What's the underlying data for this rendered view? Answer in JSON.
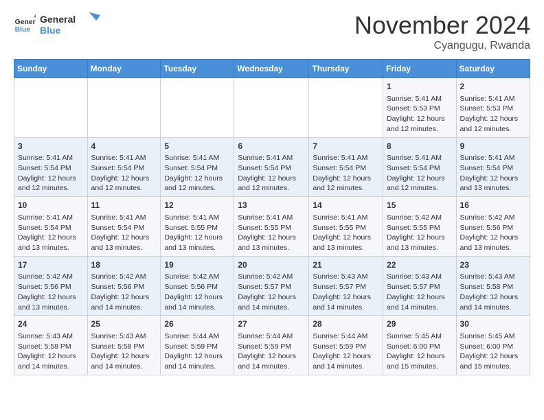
{
  "header": {
    "logo_line1": "General",
    "logo_line2": "Blue",
    "month": "November 2024",
    "location": "Cyangugu, Rwanda"
  },
  "weekdays": [
    "Sunday",
    "Monday",
    "Tuesday",
    "Wednesday",
    "Thursday",
    "Friday",
    "Saturday"
  ],
  "weeks": [
    [
      {
        "day": "",
        "info": ""
      },
      {
        "day": "",
        "info": ""
      },
      {
        "day": "",
        "info": ""
      },
      {
        "day": "",
        "info": ""
      },
      {
        "day": "",
        "info": ""
      },
      {
        "day": "1",
        "info": "Sunrise: 5:41 AM\nSunset: 5:53 PM\nDaylight: 12 hours\nand 12 minutes."
      },
      {
        "day": "2",
        "info": "Sunrise: 5:41 AM\nSunset: 5:53 PM\nDaylight: 12 hours\nand 12 minutes."
      }
    ],
    [
      {
        "day": "3",
        "info": "Sunrise: 5:41 AM\nSunset: 5:54 PM\nDaylight: 12 hours\nand 12 minutes."
      },
      {
        "day": "4",
        "info": "Sunrise: 5:41 AM\nSunset: 5:54 PM\nDaylight: 12 hours\nand 12 minutes."
      },
      {
        "day": "5",
        "info": "Sunrise: 5:41 AM\nSunset: 5:54 PM\nDaylight: 12 hours\nand 12 minutes."
      },
      {
        "day": "6",
        "info": "Sunrise: 5:41 AM\nSunset: 5:54 PM\nDaylight: 12 hours\nand 12 minutes."
      },
      {
        "day": "7",
        "info": "Sunrise: 5:41 AM\nSunset: 5:54 PM\nDaylight: 12 hours\nand 12 minutes."
      },
      {
        "day": "8",
        "info": "Sunrise: 5:41 AM\nSunset: 5:54 PM\nDaylight: 12 hours\nand 12 minutes."
      },
      {
        "day": "9",
        "info": "Sunrise: 5:41 AM\nSunset: 5:54 PM\nDaylight: 12 hours\nand 13 minutes."
      }
    ],
    [
      {
        "day": "10",
        "info": "Sunrise: 5:41 AM\nSunset: 5:54 PM\nDaylight: 12 hours\nand 13 minutes."
      },
      {
        "day": "11",
        "info": "Sunrise: 5:41 AM\nSunset: 5:54 PM\nDaylight: 12 hours\nand 13 minutes."
      },
      {
        "day": "12",
        "info": "Sunrise: 5:41 AM\nSunset: 5:55 PM\nDaylight: 12 hours\nand 13 minutes."
      },
      {
        "day": "13",
        "info": "Sunrise: 5:41 AM\nSunset: 5:55 PM\nDaylight: 12 hours\nand 13 minutes."
      },
      {
        "day": "14",
        "info": "Sunrise: 5:41 AM\nSunset: 5:55 PM\nDaylight: 12 hours\nand 13 minutes."
      },
      {
        "day": "15",
        "info": "Sunrise: 5:42 AM\nSunset: 5:55 PM\nDaylight: 12 hours\nand 13 minutes."
      },
      {
        "day": "16",
        "info": "Sunrise: 5:42 AM\nSunset: 5:56 PM\nDaylight: 12 hours\nand 13 minutes."
      }
    ],
    [
      {
        "day": "17",
        "info": "Sunrise: 5:42 AM\nSunset: 5:56 PM\nDaylight: 12 hours\nand 13 minutes."
      },
      {
        "day": "18",
        "info": "Sunrise: 5:42 AM\nSunset: 5:56 PM\nDaylight: 12 hours\nand 14 minutes."
      },
      {
        "day": "19",
        "info": "Sunrise: 5:42 AM\nSunset: 5:56 PM\nDaylight: 12 hours\nand 14 minutes."
      },
      {
        "day": "20",
        "info": "Sunrise: 5:42 AM\nSunset: 5:57 PM\nDaylight: 12 hours\nand 14 minutes."
      },
      {
        "day": "21",
        "info": "Sunrise: 5:43 AM\nSunset: 5:57 PM\nDaylight: 12 hours\nand 14 minutes."
      },
      {
        "day": "22",
        "info": "Sunrise: 5:43 AM\nSunset: 5:57 PM\nDaylight: 12 hours\nand 14 minutes."
      },
      {
        "day": "23",
        "info": "Sunrise: 5:43 AM\nSunset: 5:58 PM\nDaylight: 12 hours\nand 14 minutes."
      }
    ],
    [
      {
        "day": "24",
        "info": "Sunrise: 5:43 AM\nSunset: 5:58 PM\nDaylight: 12 hours\nand 14 minutes."
      },
      {
        "day": "25",
        "info": "Sunrise: 5:43 AM\nSunset: 5:58 PM\nDaylight: 12 hours\nand 14 minutes."
      },
      {
        "day": "26",
        "info": "Sunrise: 5:44 AM\nSunset: 5:59 PM\nDaylight: 12 hours\nand 14 minutes."
      },
      {
        "day": "27",
        "info": "Sunrise: 5:44 AM\nSunset: 5:59 PM\nDaylight: 12 hours\nand 14 minutes."
      },
      {
        "day": "28",
        "info": "Sunrise: 5:44 AM\nSunset: 5:59 PM\nDaylight: 12 hours\nand 14 minutes."
      },
      {
        "day": "29",
        "info": "Sunrise: 5:45 AM\nSunset: 6:00 PM\nDaylight: 12 hours\nand 15 minutes."
      },
      {
        "day": "30",
        "info": "Sunrise: 5:45 AM\nSunset: 6:00 PM\nDaylight: 12 hours\nand 15 minutes."
      }
    ]
  ]
}
